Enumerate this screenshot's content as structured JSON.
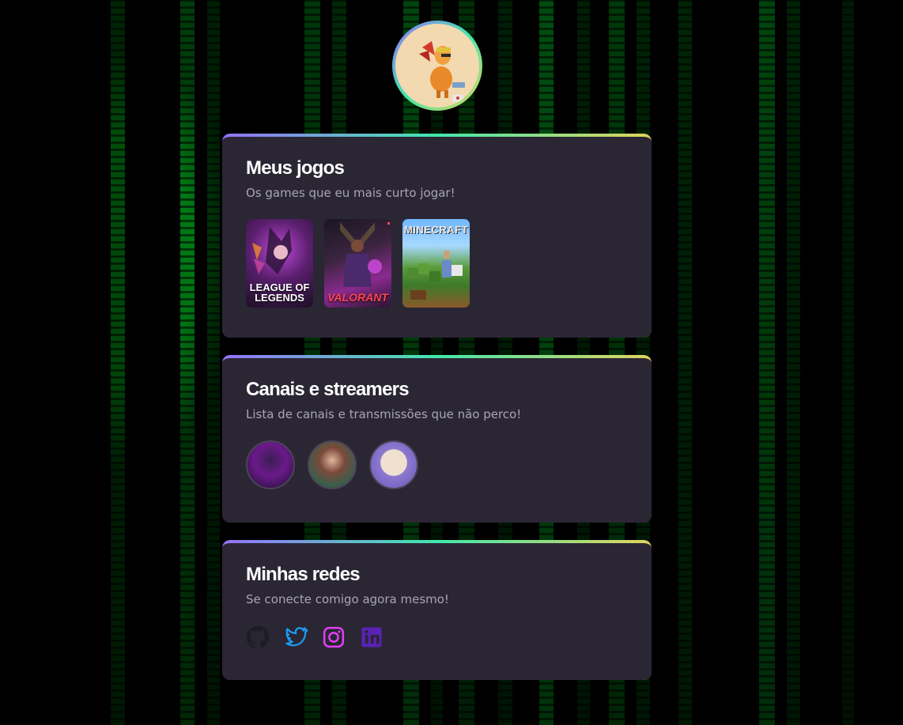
{
  "profile": {
    "avatar": "profile-avatar-dog"
  },
  "games_section": {
    "title": "Meus jogos",
    "subtitle": "Os games que eu mais curto jogar!",
    "games": [
      {
        "name": "LEAGUE OF LEGENDS",
        "label": "LEAGUE OF\nLEGENDS"
      },
      {
        "name": "VALORANT",
        "label": "VALORANT"
      },
      {
        "name": "MINECRAFT",
        "label": "MINECRAFT"
      }
    ]
  },
  "channels_section": {
    "title": "Canais e streamers",
    "subtitle": "Lista de canais e transmissões que não perco!",
    "channels": [
      "channel-avatar-1",
      "channel-avatar-2",
      "channel-avatar-3"
    ]
  },
  "social_section": {
    "title": "Minhas redes",
    "subtitle": "Se conecte comigo agora mesmo!",
    "links": [
      {
        "name": "github-icon",
        "color": "#24292e"
      },
      {
        "name": "twitter-icon",
        "color": "#1d9bf0"
      },
      {
        "name": "instagram-icon",
        "color": "#e23ff0"
      },
      {
        "name": "linkedin-icon",
        "color": "#5b21b6"
      }
    ]
  },
  "colors": {
    "card_bg": "#2a2634",
    "gradient": [
      "#9572fc",
      "#43e7ad",
      "#e2d45c"
    ],
    "title": "#ffffff",
    "subtitle": "#a9a6b3"
  }
}
